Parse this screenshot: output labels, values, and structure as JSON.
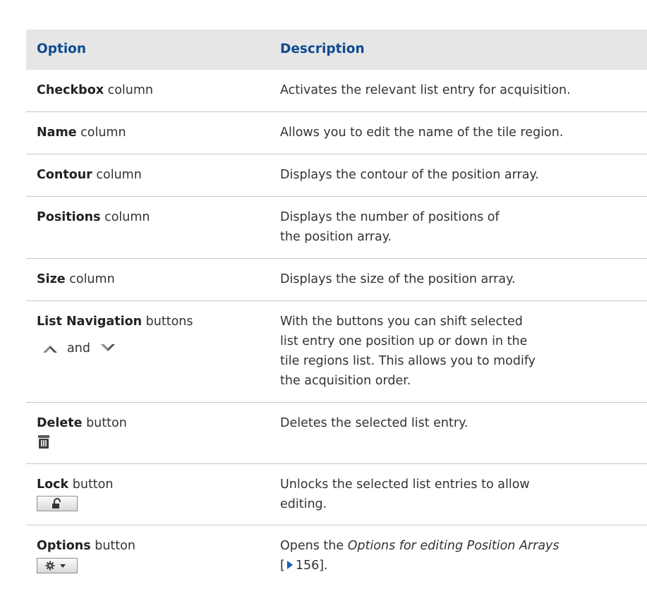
{
  "header": {
    "option": "Option",
    "description": "Description"
  },
  "rows": [
    {
      "term": "Checkbox",
      "suffix": " column",
      "description": "Activates the relevant list entry for acquisition."
    },
    {
      "term": "Name",
      "suffix": " column",
      "description": "Allows you to edit the name of the tile region."
    },
    {
      "term": "Contour",
      "suffix": " column",
      "description": "Displays the contour of the position array."
    },
    {
      "term": "Positions",
      "suffix": " column",
      "description": "Displays the number of positions of the position array."
    },
    {
      "term": "Size",
      "suffix": " column",
      "description": "Displays the size of the position array."
    },
    {
      "term": "List Navigation",
      "suffix": " buttons",
      "icon_and": "and",
      "description": "With the buttons you can shift selected list entry one position up or down in the tile regions list. This allows you to modify the acquisition order."
    },
    {
      "term": "Delete",
      "suffix": " button",
      "description": "Deletes the selected list entry."
    },
    {
      "term": "Lock",
      "suffix": " button",
      "description": "Unlocks the selected list entries to allow editing."
    },
    {
      "term": "Options",
      "suffix": " button",
      "description_prefix": "Opens the ",
      "description_link": "Options for editing Position Arrays",
      "description_ref": "156",
      "description_end": "]."
    }
  ],
  "icons": {
    "up": "chevron-up-icon",
    "down": "chevron-down-icon",
    "delete": "trash-icon",
    "lock": "unlock-icon",
    "options": "gear-dropdown-icon"
  }
}
